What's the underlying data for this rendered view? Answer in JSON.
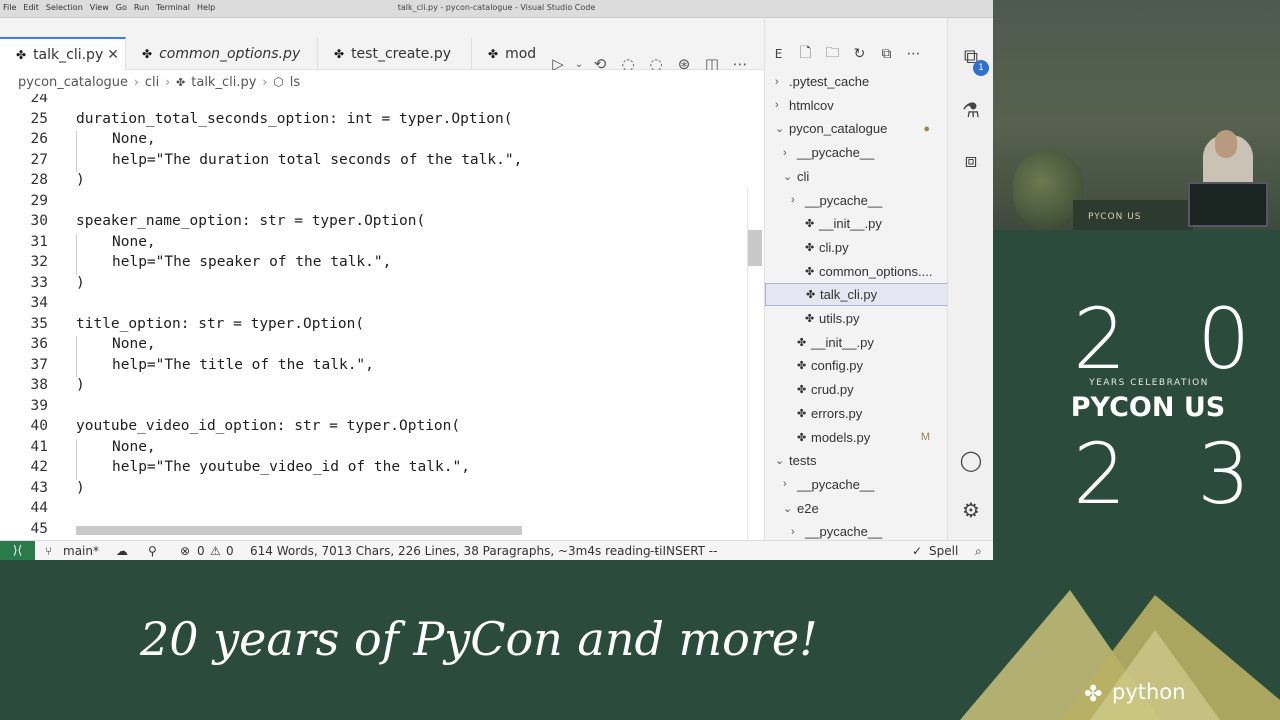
{
  "window": {
    "title": "talk_cli.py - pycon-catalogue - Visual Studio Code",
    "menu": [
      "File",
      "Edit",
      "Selection",
      "View",
      "Go",
      "Run",
      "Terminal",
      "Help"
    ]
  },
  "tabs": [
    {
      "label": "talk_cli.py",
      "active": true
    },
    {
      "label": "common_options.py",
      "active": false
    },
    {
      "label": "test_create.py",
      "active": false
    },
    {
      "label": "mod",
      "active": false
    }
  ],
  "breadcrumb": [
    "pycon_catalogue",
    "cli",
    "talk_cli.py",
    "ls"
  ],
  "editor": {
    "lines": [
      {
        "n": "24",
        "text": "",
        "indent": false
      },
      {
        "n": "25",
        "text": "duration_total_seconds_option: int = typer.Option(",
        "indent": false
      },
      {
        "n": "26",
        "text": "None,",
        "indent": true
      },
      {
        "n": "27",
        "text": "help=\"The duration total seconds of the talk.\",",
        "indent": true
      },
      {
        "n": "28",
        "text": ")",
        "indent": false
      },
      {
        "n": "29",
        "text": "",
        "indent": false
      },
      {
        "n": "30",
        "text": "speaker_name_option: str = typer.Option(",
        "indent": false
      },
      {
        "n": "31",
        "text": "None,",
        "indent": true
      },
      {
        "n": "32",
        "text": "help=\"The speaker of the talk.\",",
        "indent": true
      },
      {
        "n": "33",
        "text": ")",
        "indent": false
      },
      {
        "n": "34",
        "text": "",
        "indent": false
      },
      {
        "n": "35",
        "text": "title_option: str = typer.Option(",
        "indent": false
      },
      {
        "n": "36",
        "text": "None,",
        "indent": true
      },
      {
        "n": "37",
        "text": "help=\"The title of the talk.\",",
        "indent": true
      },
      {
        "n": "38",
        "text": ")",
        "indent": false
      },
      {
        "n": "39",
        "text": "",
        "indent": false
      },
      {
        "n": "40",
        "text": "youtube_video_id_option: str = typer.Option(",
        "indent": false
      },
      {
        "n": "41",
        "text": "None,",
        "indent": true
      },
      {
        "n": "42",
        "text": "help=\"The youtube_video_id of the talk.\",",
        "indent": true
      },
      {
        "n": "43",
        "text": ")",
        "indent": false
      },
      {
        "n": "44",
        "text": "",
        "indent": false
      },
      {
        "n": "45",
        "text": "",
        "indent": false
      }
    ]
  },
  "explorer": {
    "items": [
      {
        "label": ".pytest_cache",
        "kind": "folder",
        "open": false,
        "depth": 1
      },
      {
        "label": "htmlcov",
        "kind": "folder",
        "open": false,
        "depth": 1
      },
      {
        "label": "pycon_catalogue",
        "kind": "folder",
        "open": true,
        "depth": 1,
        "badge": "●"
      },
      {
        "label": "__pycache__",
        "kind": "folder",
        "open": false,
        "depth": 2
      },
      {
        "label": "cli",
        "kind": "folder",
        "open": true,
        "depth": 2
      },
      {
        "label": "__pycache__",
        "kind": "folder",
        "open": false,
        "depth": 3
      },
      {
        "label": "__init__.py",
        "kind": "file",
        "depth": 3
      },
      {
        "label": "cli.py",
        "kind": "file",
        "depth": 3
      },
      {
        "label": "common_options....",
        "kind": "file",
        "depth": 3
      },
      {
        "label": "talk_cli.py",
        "kind": "file",
        "depth": 3,
        "selected": true
      },
      {
        "label": "utils.py",
        "kind": "file",
        "depth": 3
      },
      {
        "label": "__init__.py",
        "kind": "file",
        "depth": 2
      },
      {
        "label": "config.py",
        "kind": "file",
        "depth": 2
      },
      {
        "label": "crud.py",
        "kind": "file",
        "depth": 2
      },
      {
        "label": "errors.py",
        "kind": "file",
        "depth": 2
      },
      {
        "label": "models.py",
        "kind": "file",
        "depth": 2,
        "badge": "M"
      },
      {
        "label": "tests",
        "kind": "folder",
        "open": true,
        "depth": 1
      },
      {
        "label": "__pycache__",
        "kind": "folder",
        "open": false,
        "depth": 2
      },
      {
        "label": "e2e",
        "kind": "folder",
        "open": true,
        "depth": 2
      },
      {
        "label": "__pycache__",
        "kind": "folder",
        "open": false,
        "depth": 3
      }
    ]
  },
  "activity": {
    "badge": "1"
  },
  "status": {
    "branch": "main*",
    "errors": "0",
    "warnings": "0",
    "stats": "614 Words, 7013 Chars, 226 Lines, 38 Paragraphs, ~3m4s reading ti",
    "mode": "-- INSERT --",
    "spell": "Spell"
  },
  "overlay": {
    "camera_label": "PYCON US",
    "year_top": "2 0",
    "years_celebration": "YEARS CELEBRATION",
    "pycon_us": "PYCON US",
    "year_bottom": "2 3",
    "tagline": "20 years of PyCon and more!",
    "python_org": "python"
  }
}
